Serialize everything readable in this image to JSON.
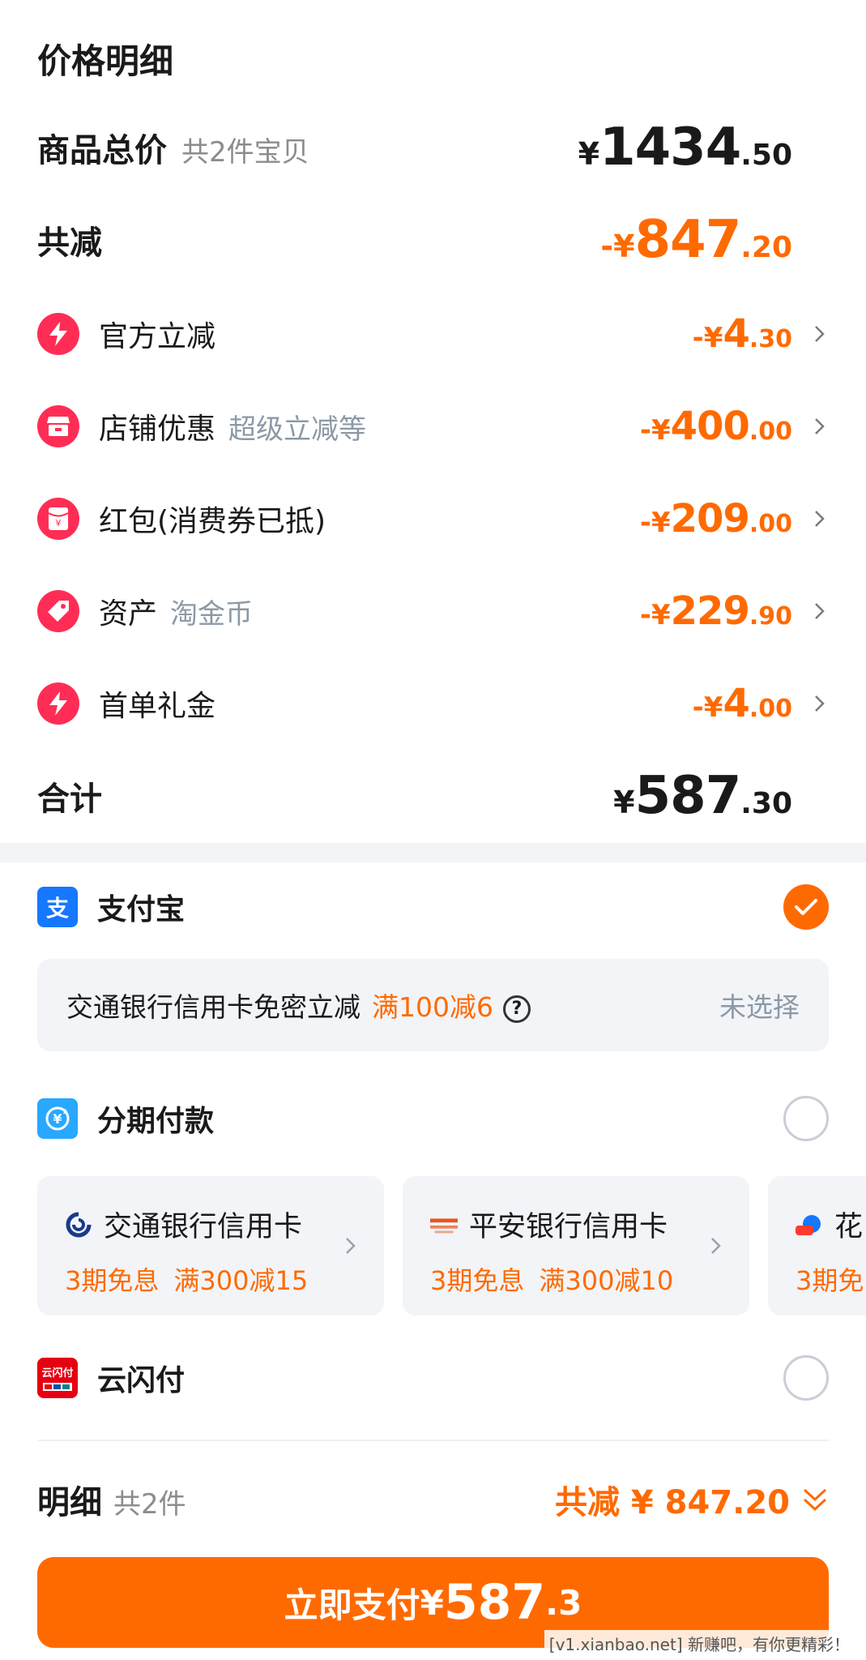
{
  "price_detail": {
    "title": "价格明细",
    "total": {
      "label": "商品总价",
      "sub": "共2件宝贝",
      "yen": "¥",
      "int": "1434",
      "dec": ".50"
    },
    "reduced": {
      "label": "共减",
      "yen": "-¥",
      "int": "847",
      "dec": ".20"
    },
    "discounts": [
      {
        "label": "官方立减",
        "sub": "",
        "icon": "lightning-icon",
        "yen": "-¥",
        "int": "4",
        "dec": ".30"
      },
      {
        "label": "店铺优惠",
        "sub": "超级立减等",
        "icon": "shop-icon",
        "yen": "-¥",
        "int": "400",
        "dec": ".00"
      },
      {
        "label": "红包(消费券已抵)",
        "sub": "",
        "icon": "red-packet-icon",
        "yen": "-¥",
        "int": "209",
        "dec": ".00"
      },
      {
        "label": "资产",
        "sub": "淘金币",
        "icon": "tag-icon",
        "yen": "-¥",
        "int": "229",
        "dec": ".90"
      },
      {
        "label": "首单礼金",
        "sub": "",
        "icon": "lightning-icon",
        "yen": "-¥",
        "int": "4",
        "dec": ".00"
      }
    ],
    "sum": {
      "label": "合计",
      "yen": "¥",
      "int": "587",
      "dec": ".30"
    }
  },
  "payment": {
    "alipay": {
      "label": "支付宝",
      "icon": "alipay-icon",
      "selected": true
    },
    "promo": {
      "text": "交通银行信用卡免密立减",
      "offer": "满100减6",
      "help_icon": "?",
      "status": "未选择"
    },
    "installment": {
      "label": "分期付款",
      "icon": "installment-icon",
      "selected": false,
      "cards": [
        {
          "bank": "交通银行信用卡",
          "icon": "bocom-logo-icon",
          "free": "3期免息",
          "offer": "满300减15"
        },
        {
          "bank": "平安银行信用卡",
          "icon": "pingan-logo-icon",
          "free": "3期免息",
          "offer": "满300减10"
        },
        {
          "bank": "花",
          "icon": "huabei-logo-icon",
          "free": "3期免",
          "offer": ""
        }
      ]
    },
    "unionpay": {
      "label": "云闪付",
      "icon": "unionpay-icon",
      "selected": false
    },
    "detail": {
      "label": "明细",
      "sub": "共2件",
      "summary": "共减 ¥ 847.20"
    },
    "pay_button": {
      "text": "立即支付",
      "yen": "¥",
      "int": "587",
      "dec": ".3"
    }
  },
  "watermark": "[v1.xianbao.net] 新赚吧，有你更精彩！",
  "colors": {
    "accent": "#ff6a00",
    "discount_icon": "#ff2d55",
    "alipay": "#1677ff",
    "installment": "#29a8ff",
    "unionpay": "#e60012"
  }
}
